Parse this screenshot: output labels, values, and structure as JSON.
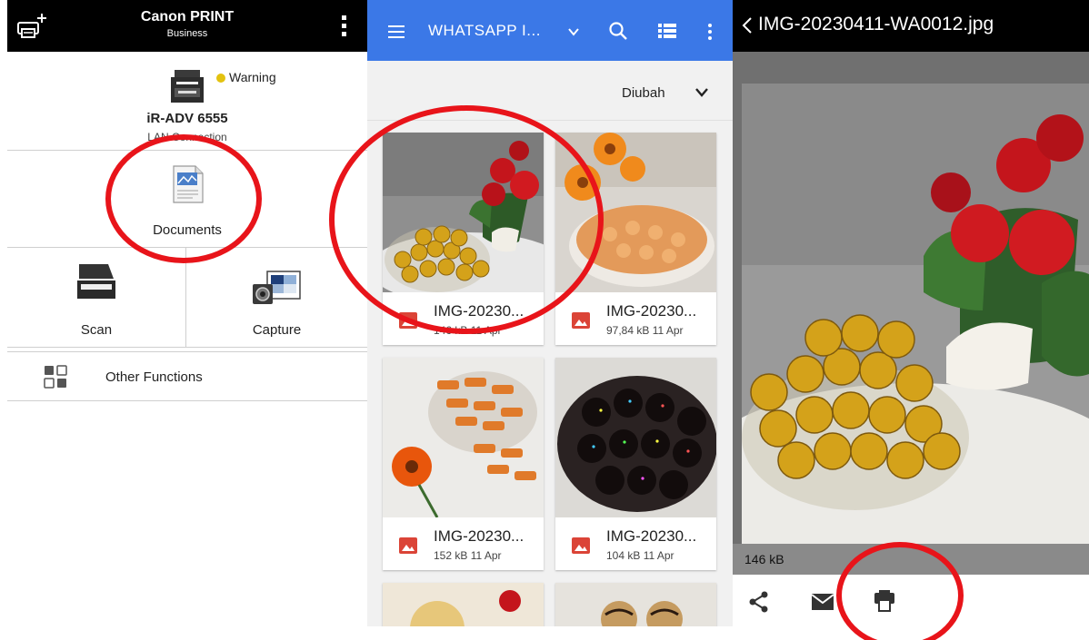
{
  "canon": {
    "app_title": "Canon PRINT",
    "app_subtitle": "Business",
    "printer_status": "Warning",
    "printer_model": "iR-ADV 6555",
    "connection": "LAN Connection",
    "documents_label": "Documents",
    "scan_label": "Scan",
    "capture_label": "Capture",
    "other_label": "Other Functions",
    "status_color": "#e3c20f"
  },
  "picker": {
    "folder_title": "WHATSAPP I...",
    "sort_label": "Diubah",
    "accent": "#3b78e7",
    "files": [
      {
        "name": "IMG-20230...",
        "info": "146 kB 11 Apr"
      },
      {
        "name": "IMG-20230...",
        "info": "97,84 kB 11 Apr"
      },
      {
        "name": "IMG-20230...",
        "info": "152 kB 11 Apr"
      },
      {
        "name": "IMG-20230...",
        "info": "104 kB 11 Apr"
      }
    ]
  },
  "preview": {
    "file_title": "IMG-20230411-WA0012.jpg",
    "file_size": "146 kB"
  },
  "annotations": {
    "ring_color": "#e8141a"
  }
}
